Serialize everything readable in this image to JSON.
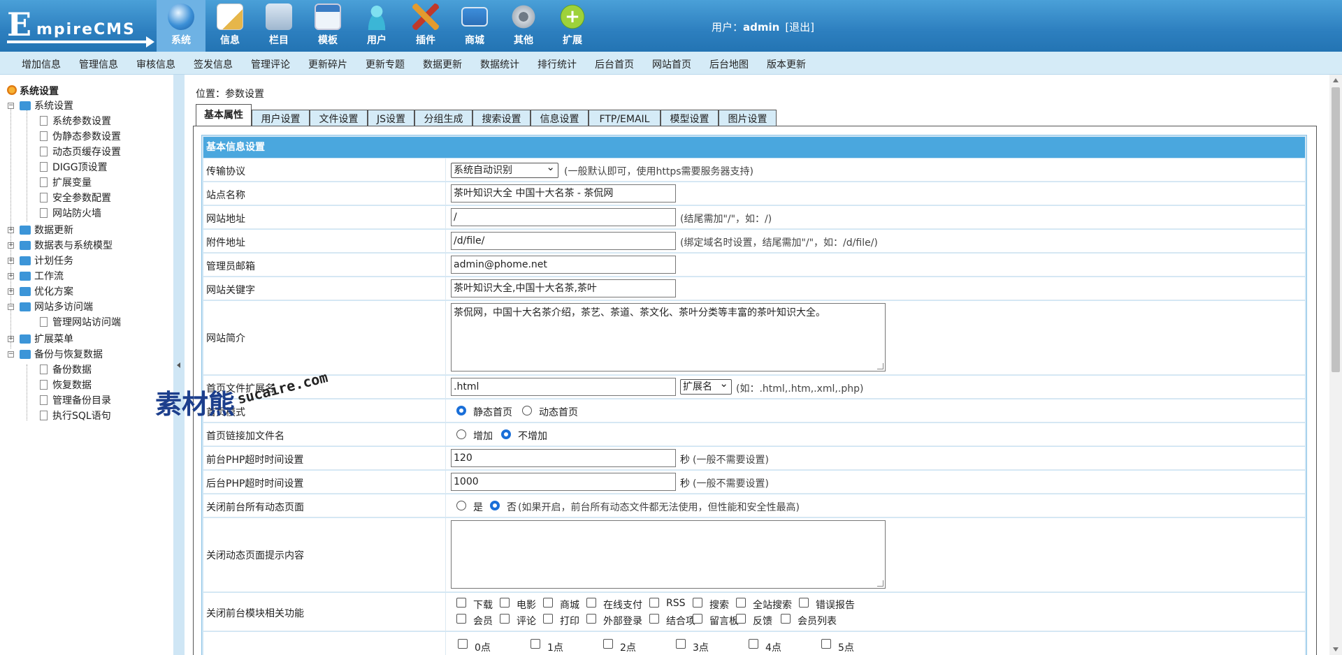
{
  "header": {
    "logo_big": "E",
    "logo_small": "mpireCMS",
    "nav": [
      {
        "label": "系统",
        "icon": "globe-icon",
        "active": true
      },
      {
        "label": "信息",
        "icon": "edit-icon"
      },
      {
        "label": "栏目",
        "icon": "folder-icon"
      },
      {
        "label": "模板",
        "icon": "window-icon"
      },
      {
        "label": "用户",
        "icon": "user-icon"
      },
      {
        "label": "插件",
        "icon": "plugin-icon"
      },
      {
        "label": "商城",
        "icon": "card-icon"
      },
      {
        "label": "其他",
        "icon": "gear-icon"
      },
      {
        "label": "扩展",
        "icon": "plus-icon"
      }
    ],
    "user_label": "用户：",
    "user_name": "admin",
    "logout": "[退出]"
  },
  "menubar": [
    "增加信息",
    "管理信息",
    "审核信息",
    "签发信息",
    "管理评论",
    "更新碎片",
    "更新专题",
    "数据更新",
    "数据统计",
    "排行统计",
    "后台首页",
    "网站首页",
    "后台地图",
    "版本更新"
  ],
  "sidebar": {
    "root": "系统设置",
    "items": [
      {
        "label": "系统设置",
        "level": 1,
        "expanded": true
      },
      {
        "label": "系统参数设置",
        "level": 2
      },
      {
        "label": "伪静态参数设置",
        "level": 2
      },
      {
        "label": "动态页缓存设置",
        "level": 2
      },
      {
        "label": "DIGG顶设置",
        "level": 2
      },
      {
        "label": "扩展变量",
        "level": 2
      },
      {
        "label": "安全参数配置",
        "level": 2
      },
      {
        "label": "网站防火墙",
        "level": 2
      },
      {
        "label": "数据更新",
        "level": 1
      },
      {
        "label": "数据表与系统模型",
        "level": 1
      },
      {
        "label": "计划任务",
        "level": 1
      },
      {
        "label": "工作流",
        "level": 1
      },
      {
        "label": "优化方案",
        "level": 1
      },
      {
        "label": "网站多访问端",
        "level": 1,
        "expanded": true
      },
      {
        "label": "管理网站访问端",
        "level": 2
      },
      {
        "label": "扩展菜单",
        "level": 1
      },
      {
        "label": "备份与恢复数据",
        "level": 1,
        "expanded": true
      },
      {
        "label": "备份数据",
        "level": 2
      },
      {
        "label": "恢复数据",
        "level": 2
      },
      {
        "label": "管理备份目录",
        "level": 2
      },
      {
        "label": "执行SQL语句",
        "level": 2
      }
    ]
  },
  "breadcrumb": {
    "prefix": "位置：",
    "current": "参数设置"
  },
  "tabs": [
    "基本属性",
    "用户设置",
    "文件设置",
    "JS设置",
    "分组生成",
    "搜索设置",
    "信息设置",
    "FTP/EMAIL",
    "模型设置",
    "图片设置"
  ],
  "form": {
    "section_title": "基本信息设置",
    "protocol": {
      "label": "传输协议",
      "value": "系统自动识别",
      "hint": "(一般默认即可，使用https需要服务器支持)"
    },
    "site_name": {
      "label": "站点名称",
      "value": "茶叶知识大全 中国十大名茶 - 茶侃网"
    },
    "site_url": {
      "label": "网站地址",
      "value": "/",
      "hint": "(结尾需加\"/\"，如：/)"
    },
    "file_url": {
      "label": "附件地址",
      "value": "/d/file/",
      "hint": "(绑定域名时设置，结尾需加\"/\"，如：/d/file/)"
    },
    "email": {
      "label": "管理员邮箱",
      "value": "admin@phome.net"
    },
    "keywords": {
      "label": "网站关键字",
      "value": "茶叶知识大全,中国十大名茶,茶叶"
    },
    "intro": {
      "label": "网站简介",
      "value": "茶侃网，中国十大名茶介绍，茶艺、茶道、茶文化、茶叶分类等丰富的茶叶知识大全。"
    },
    "index_ext": {
      "label": "首页文件扩展名",
      "value": ".html",
      "select": "扩展名",
      "hint": "(如：.html,.htm,.xml,.php)"
    },
    "index_mode": {
      "label": "首页模式",
      "options": [
        "静态首页",
        "动态首页"
      ],
      "selected": 0
    },
    "index_link": {
      "label": "首页链接加文件名",
      "options": [
        "增加",
        "不增加"
      ],
      "selected": 1
    },
    "front_timeout": {
      "label": "前台PHP超时时间设置",
      "value": "120",
      "unit": "秒",
      "hint": "(一般不需要设置)"
    },
    "back_timeout": {
      "label": "后台PHP超时时间设置",
      "value": "1000",
      "unit": "秒",
      "hint": "(一般不需要设置)"
    },
    "close_dynamic": {
      "label": "关闭前台所有动态页面",
      "options": [
        "是",
        "否"
      ],
      "selected": 1,
      "hint": "(如果开启，前台所有动态文件都无法使用，但性能和安全性最高)"
    },
    "close_tip": {
      "label": "关闭动态页面提示内容",
      "value": ""
    },
    "close_modules": {
      "label": "关闭前台模块相关功能",
      "row1": [
        "下载",
        "电影",
        "商城",
        "在线支付",
        "RSS",
        "搜索",
        "全站搜索",
        "错误报告"
      ],
      "row2": [
        "会员",
        "评论",
        "打印",
        "外部登录",
        "结合项",
        "留言板",
        "反馈",
        "会员列表"
      ]
    },
    "hours": [
      "0点",
      "1点",
      "2点",
      "3点",
      "4点",
      "5点"
    ]
  },
  "watermark": {
    "main": "素材熊",
    "url": "sucaire.com"
  },
  "colors": {
    "header": "#2d7fbf",
    "menubar": "#d5ebf7",
    "section": "#4aa7de",
    "accent": "#1a6fd8"
  }
}
